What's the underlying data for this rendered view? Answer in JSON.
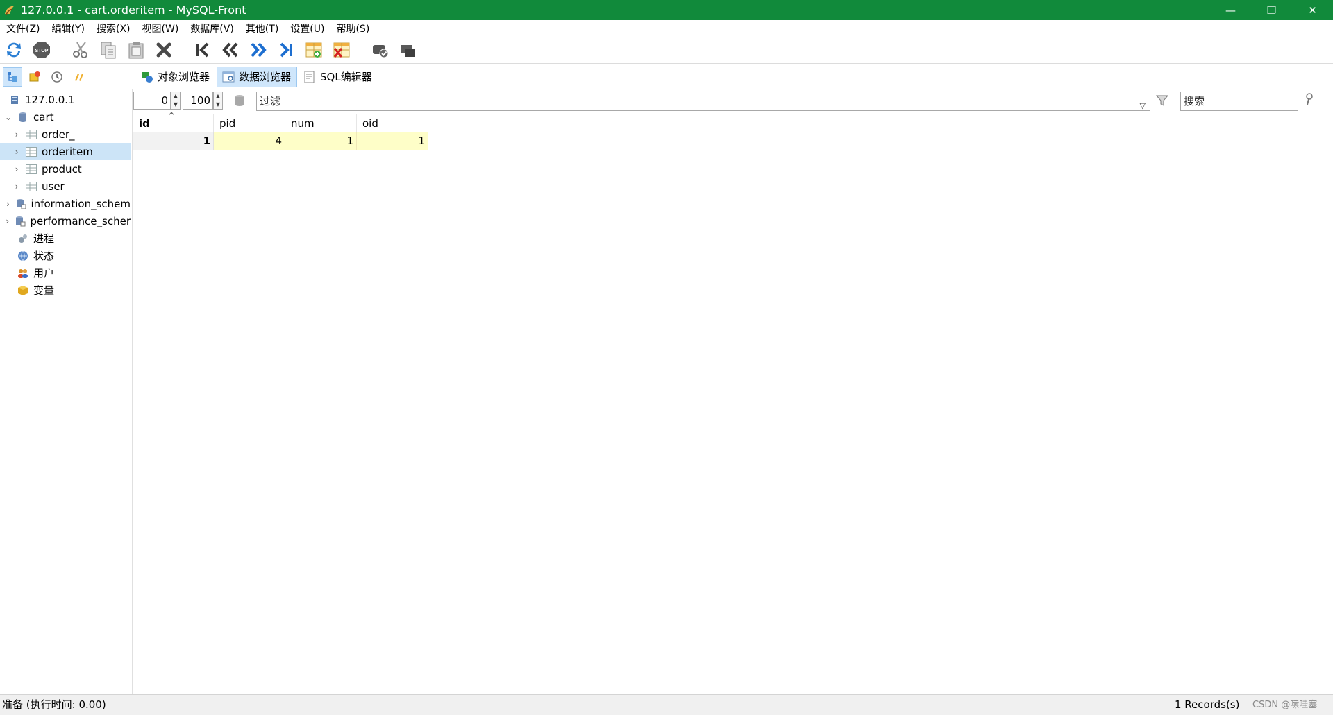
{
  "window": {
    "title": "127.0.0.1 - cart.orderitem - MySQL-Front",
    "controls": {
      "minimize": "—",
      "restore": "❐",
      "close": "✕"
    }
  },
  "menu": [
    "文件(Z)",
    "编辑(Y)",
    "搜索(X)",
    "视图(W)",
    "数据库(V)",
    "其他(T)",
    "设置(U)",
    "帮助(S)"
  ],
  "toolbar": {
    "icons": [
      "refresh-icon",
      "stop-icon",
      "cut-icon",
      "copy-icon",
      "paste-icon",
      "delete-icon",
      "first-record-icon",
      "previous-records-icon",
      "next-records-icon",
      "last-record-icon",
      "insert-record-icon",
      "delete-record-icon",
      "post-record-icon",
      "cancel-record-icon"
    ],
    "stop_text": "STOP"
  },
  "views": {
    "sidebar_tabs": [
      "navigator-icon",
      "bookmarks-icon",
      "history-icon",
      "explorer-icon"
    ],
    "tabs": [
      {
        "label": "对象浏览器",
        "icon": "object-browser-icon"
      },
      {
        "label": "数据浏览器",
        "icon": "data-browser-icon"
      },
      {
        "label": "SQL编辑器",
        "icon": "sql-editor-icon"
      }
    ],
    "active_tab": "数据浏览器"
  },
  "tree": {
    "host": "127.0.0.1",
    "database": "cart",
    "tables": [
      "order_",
      "orderitem",
      "product",
      "user"
    ],
    "selected_table": "orderitem",
    "other_databases": [
      "information_schem",
      "performance_scher"
    ],
    "system_items": [
      "进程",
      "状态",
      "用户",
      "变量"
    ]
  },
  "filter": {
    "offset": "0",
    "limit": "100",
    "filter_placeholder": "过滤",
    "search_placeholder": "搜索",
    "sort_indicator": "^"
  },
  "grid": {
    "columns": [
      "id",
      "pid",
      "num",
      "oid"
    ],
    "rows": [
      [
        "1",
        "4",
        "1",
        "1"
      ]
    ]
  },
  "status": {
    "left": "准备  (执行时间: 0.00)",
    "records": "1 Records(s)",
    "watermark": "CSDN @嗦哇塞"
  },
  "colors": {
    "titlebar": "#118a3b",
    "selection": "#cce4f7",
    "cell_highlight": "#fefec8"
  }
}
